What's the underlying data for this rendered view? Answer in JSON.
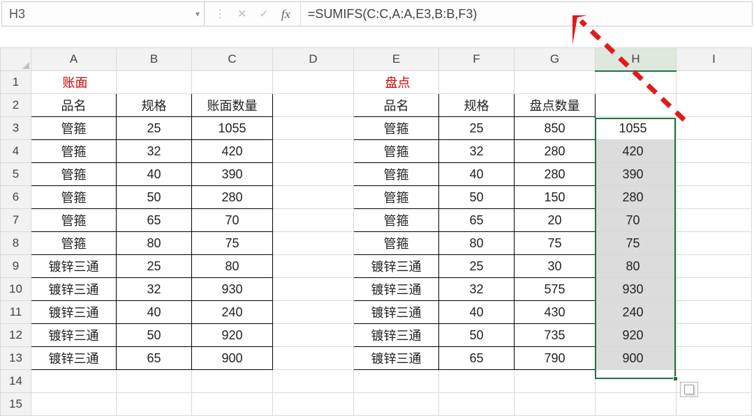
{
  "namebox": {
    "value": "H3"
  },
  "formula": {
    "value": "=SUMIFS(C:C,A:A,E3,B:B,F3)"
  },
  "columns": [
    "A",
    "B",
    "C",
    "D",
    "E",
    "F",
    "G",
    "H",
    "I"
  ],
  "row_labels": [
    "1",
    "2",
    "3",
    "4",
    "5",
    "6",
    "7",
    "8",
    "9",
    "10",
    "11",
    "12",
    "13",
    "14",
    "15"
  ],
  "section_titles": {
    "left": "账面",
    "right": "盘点"
  },
  "headers_left": {
    "name": "品名",
    "spec": "规格",
    "qty": "账面数量"
  },
  "headers_right": {
    "name": "品名",
    "spec": "规格",
    "qty": "盘点数量"
  },
  "rows": [
    {
      "ln": "管箍",
      "ls": "25",
      "lq": "1055",
      "rn": "管箍",
      "rs": "25",
      "rq": "850",
      "h": "1055"
    },
    {
      "ln": "管箍",
      "ls": "32",
      "lq": "420",
      "rn": "管箍",
      "rs": "32",
      "rq": "280",
      "h": "420"
    },
    {
      "ln": "管箍",
      "ls": "40",
      "lq": "390",
      "rn": "管箍",
      "rs": "40",
      "rq": "280",
      "h": "390"
    },
    {
      "ln": "管箍",
      "ls": "50",
      "lq": "280",
      "rn": "管箍",
      "rs": "50",
      "rq": "150",
      "h": "280"
    },
    {
      "ln": "管箍",
      "ls": "65",
      "lq": "70",
      "rn": "管箍",
      "rs": "65",
      "rq": "20",
      "h": "70"
    },
    {
      "ln": "管箍",
      "ls": "80",
      "lq": "75",
      "rn": "管箍",
      "rs": "80",
      "rq": "75",
      "h": "75"
    },
    {
      "ln": "镀锌三通",
      "ls": "25",
      "lq": "80",
      "rn": "镀锌三通",
      "rs": "25",
      "rq": "30",
      "h": "80"
    },
    {
      "ln": "镀锌三通",
      "ls": "32",
      "lq": "930",
      "rn": "镀锌三通",
      "rs": "32",
      "rq": "575",
      "h": "930"
    },
    {
      "ln": "镀锌三通",
      "ls": "40",
      "lq": "240",
      "rn": "镀锌三通",
      "rs": "40",
      "rq": "430",
      "h": "240"
    },
    {
      "ln": "镀锌三通",
      "ls": "50",
      "lq": "920",
      "rn": "镀锌三通",
      "rs": "50",
      "rq": "735",
      "h": "920"
    },
    {
      "ln": "镀锌三通",
      "ls": "65",
      "lq": "900",
      "rn": "镀锌三通",
      "rs": "65",
      "rq": "790",
      "h": "900"
    }
  ],
  "col_widths": {
    "rowhdr": 44,
    "A": 122,
    "B": 108,
    "C": 116,
    "D": 116,
    "E": 122,
    "F": 108,
    "G": 116,
    "H": 116,
    "I": 108
  },
  "selected_col": "H"
}
